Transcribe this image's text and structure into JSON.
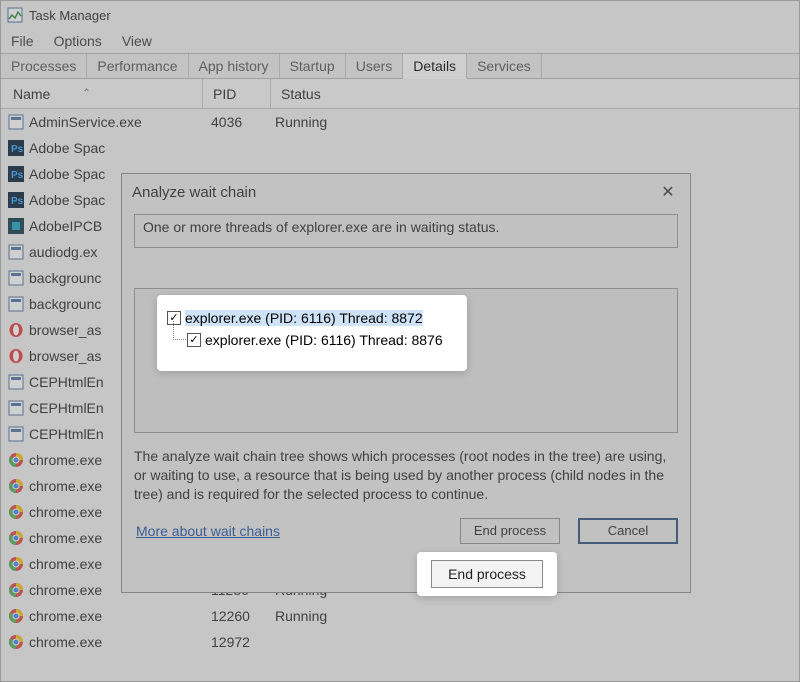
{
  "window": {
    "title": "Task Manager",
    "menu": [
      "File",
      "Options",
      "View"
    ],
    "tabs": [
      "Processes",
      "Performance",
      "App history",
      "Startup",
      "Users",
      "Details",
      "Services"
    ],
    "active_tab": "Details"
  },
  "columns": {
    "name": "Name",
    "pid": "PID",
    "status": "Status"
  },
  "processes": [
    {
      "icon": "generic",
      "name": "AdminService.exe",
      "pid": "4036",
      "status": "Running"
    },
    {
      "icon": "photoshop",
      "name": "Adobe Spac",
      "pid": "",
      "status": ""
    },
    {
      "icon": "photoshop",
      "name": "Adobe Spac",
      "pid": "",
      "status": ""
    },
    {
      "icon": "photoshop",
      "name": "Adobe Spac",
      "pid": "",
      "status": ""
    },
    {
      "icon": "adobe",
      "name": "AdobeIPCB",
      "pid": "",
      "status": ""
    },
    {
      "icon": "generic",
      "name": "audiodg.ex",
      "pid": "",
      "status": ""
    },
    {
      "icon": "generic",
      "name": "backgrounc",
      "pid": "",
      "status": ""
    },
    {
      "icon": "generic",
      "name": "backgrounc",
      "pid": "",
      "status": ""
    },
    {
      "icon": "opera",
      "name": "browser_as",
      "pid": "",
      "status": ""
    },
    {
      "icon": "opera",
      "name": "browser_as",
      "pid": "",
      "status": ""
    },
    {
      "icon": "generic",
      "name": "CEPHtmlEn",
      "pid": "",
      "status": ""
    },
    {
      "icon": "generic",
      "name": "CEPHtmlEn",
      "pid": "",
      "status": ""
    },
    {
      "icon": "generic",
      "name": "CEPHtmlEn",
      "pid": "",
      "status": ""
    },
    {
      "icon": "chrome",
      "name": "chrome.exe",
      "pid": "",
      "status": ""
    },
    {
      "icon": "chrome",
      "name": "chrome.exe",
      "pid": "",
      "status": ""
    },
    {
      "icon": "chrome",
      "name": "chrome.exe",
      "pid": "",
      "status": ""
    },
    {
      "icon": "chrome",
      "name": "chrome.exe",
      "pid": "",
      "status": ""
    },
    {
      "icon": "chrome",
      "name": "chrome.exe",
      "pid": "",
      "status": ""
    },
    {
      "icon": "chrome",
      "name": "chrome.exe",
      "pid": "11280",
      "status": "Running"
    },
    {
      "icon": "chrome",
      "name": "chrome.exe",
      "pid": "12260",
      "status": "Running"
    },
    {
      "icon": "chrome",
      "name": "chrome.exe",
      "pid": "12972",
      "status": ""
    }
  ],
  "dialog": {
    "title": "Analyze wait chain",
    "info": "One or more threads of explorer.exe are in waiting status.",
    "tree": [
      {
        "label": "explorer.exe (PID: 6116) Thread: 8872",
        "checked": true,
        "selected": true
      },
      {
        "label": "explorer.exe (PID: 6116) Thread: 8876",
        "checked": true,
        "selected": false
      }
    ],
    "explain": "The analyze wait chain tree shows which processes (root nodes in the tree) are using, or waiting to use, a resource that is being used by another process (child nodes in the tree) and is required for the selected process to continue.",
    "link": "More about wait chains",
    "end_process": "End process",
    "cancel": "Cancel"
  }
}
